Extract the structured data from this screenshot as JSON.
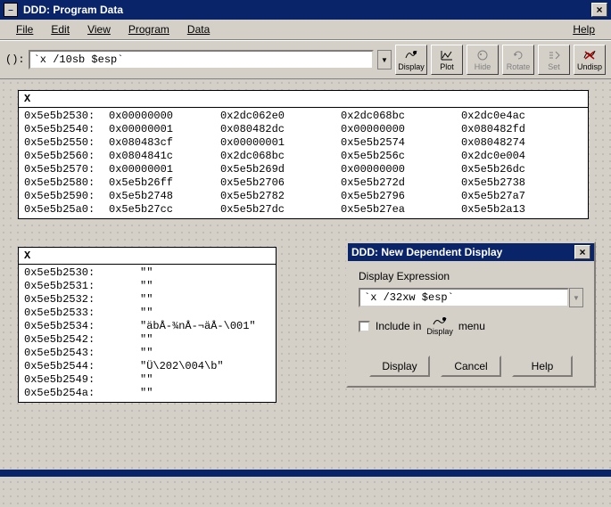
{
  "window": {
    "title": "DDD: Program Data",
    "menus": {
      "file": "File",
      "edit": "Edit",
      "view": "View",
      "program": "Program",
      "data": "Data",
      "help": "Help"
    }
  },
  "toolbar": {
    "prefix": "():",
    "input_value": "`x /10sb $esp`",
    "display": "Display",
    "plot": "Plot",
    "hide": "Hide",
    "rotate": "Rotate",
    "set": "Set",
    "undisp": "Undisp"
  },
  "panel1": {
    "header": "X",
    "rows": [
      [
        "0x5e5b2530:",
        "0x00000000",
        "0x2dc062e0",
        "0x2dc068bc",
        "0x2dc0e4ac"
      ],
      [
        "0x5e5b2540:",
        "0x00000001",
        "0x080482dc",
        "0x00000000",
        "0x080482fd"
      ],
      [
        "0x5e5b2550:",
        "0x080483cf",
        "0x00000001",
        "0x5e5b2574",
        "0x08048274"
      ],
      [
        "0x5e5b2560:",
        "0x0804841c",
        "0x2dc068bc",
        "0x5e5b256c",
        "0x2dc0e004"
      ],
      [
        "0x5e5b2570:",
        "0x00000001",
        "0x5e5b269d",
        "0x00000000",
        "0x5e5b26dc"
      ],
      [
        "0x5e5b2580:",
        "0x5e5b26ff",
        "0x5e5b2706",
        "0x5e5b272d",
        "0x5e5b2738"
      ],
      [
        "0x5e5b2590:",
        "0x5e5b2748",
        "0x5e5b2782",
        "0x5e5b2796",
        "0x5e5b27a7"
      ],
      [
        "0x5e5b25a0:",
        "0x5e5b27cc",
        "0x5e5b27dc",
        "0x5e5b27ea",
        "0x5e5b2a13"
      ]
    ]
  },
  "panel2": {
    "header": "X",
    "rows": [
      [
        "0x5e5b2530:",
        "\"\""
      ],
      [
        "0x5e5b2531:",
        "\"\""
      ],
      [
        "0x5e5b2532:",
        "\"\""
      ],
      [
        "0x5e5b2533:",
        "\"\""
      ],
      [
        "0x5e5b2534:",
        "\"äbÅ-¾nÅ-¬äÅ-\\001\""
      ],
      [
        "0x5e5b2542:",
        "\"\""
      ],
      [
        "0x5e5b2543:",
        "\"\""
      ],
      [
        "0x5e5b2544:",
        "\"Ü\\202\\004\\b\""
      ],
      [
        "0x5e5b2549:",
        "\"\""
      ],
      [
        "0x5e5b254a:",
        "\"\""
      ]
    ]
  },
  "dialog": {
    "title": "DDD: New Dependent Display",
    "group_label": "Display Expression",
    "expr_value": "`x /32xw $esp`",
    "include_label_pre": "Include in",
    "include_icon_label": "Display",
    "include_label_post": "menu",
    "buttons": {
      "display": "Display",
      "cancel": "Cancel",
      "help": "Help"
    }
  }
}
